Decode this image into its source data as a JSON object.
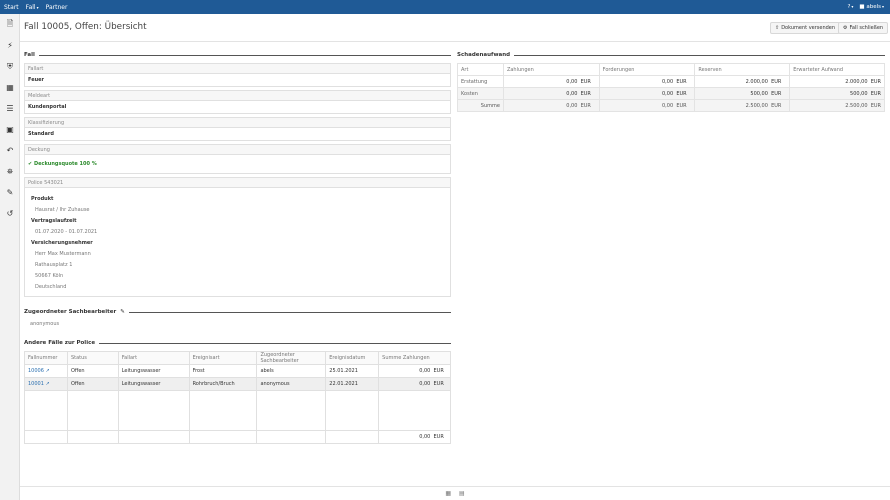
{
  "topbar": {
    "start": "Start",
    "fall": "Fall",
    "partner": "Partner",
    "help": "?",
    "user": "abels"
  },
  "sidebar": {
    "icons": [
      "document-icon",
      "bolt-icon",
      "shield-icon",
      "gift-icon",
      "list-icon",
      "card-icon",
      "reply-icon",
      "bank-icon",
      "edit-icon",
      "history-icon"
    ]
  },
  "header": {
    "title": "Fall 10005, Offen: Übersicht",
    "send_document": "Dokument versenden",
    "close_case": "Fall schließen"
  },
  "fall": {
    "section_title": "Fall",
    "fallart_label": "Fallart",
    "fallart_value": "Feuer",
    "meldeart_label": "Meldeart",
    "meldeart_value": "Kundenportal",
    "klass_label": "Klassifizierung",
    "klass_value": "Standard",
    "deckung_label": "Deckung",
    "deckung_value": "Deckungsquote 100 %",
    "police_label": "Police 543021",
    "produkt_label": "Produkt",
    "produkt_value": "Hausrat / Ihr Zuhause",
    "laufzeit_label": "Vertragslaufzeit",
    "laufzeit_value": "01.07.2020 - 01.07.2021",
    "vn_label": "Versicherungsnehmer",
    "vn_name": "Herr Max Mustermann",
    "vn_street": "Rathausplatz 1",
    "vn_city": "50667 Köln",
    "vn_country": "Deutschland"
  },
  "sachbearbeiter": {
    "title": "Zugeordneter Sachbearbeiter",
    "value": "anonymous"
  },
  "schaden": {
    "title": "Schadenaufwand",
    "headers": [
      "Art",
      "Zahlungen",
      "Forderungen",
      "Reserven",
      "Erwarteter Aufwand"
    ],
    "rows": [
      {
        "art": "Erstattung",
        "zahlungen": "0,00",
        "forderungen": "0,00",
        "reserven": "2.000,00",
        "erwartet": "2.000,00"
      },
      {
        "art": "Kosten",
        "zahlungen": "0,00",
        "forderungen": "0,00",
        "reserven": "500,00",
        "erwartet": "500,00"
      },
      {
        "art": "Summe",
        "zahlungen": "0,00",
        "forderungen": "0,00",
        "reserven": "2.500,00",
        "erwartet": "2.500,00"
      }
    ],
    "currency": "EUR"
  },
  "andere": {
    "title": "Andere Fälle zur Police",
    "headers": [
      "Fallnummer",
      "Status",
      "Fallart",
      "Ereignisart",
      "Zugeordneter Sachbearbeiter",
      "Ereignisdatum",
      "Summe Zahlungen"
    ],
    "rows": [
      {
        "nr": "10006",
        "status": "Offen",
        "fallart": "Leitungswasser",
        "ereignis": "Frost",
        "sb": "abels",
        "datum": "25.01.2021",
        "summe": "0,00"
      },
      {
        "nr": "10001",
        "status": "Offen",
        "fallart": "Leitungswasser",
        "ereignis": "Rohrbruch/Bruch",
        "sb": "anonymous",
        "datum": "22.01.2021",
        "summe": "0,00"
      }
    ],
    "total": "0,00",
    "currency": "EUR"
  }
}
